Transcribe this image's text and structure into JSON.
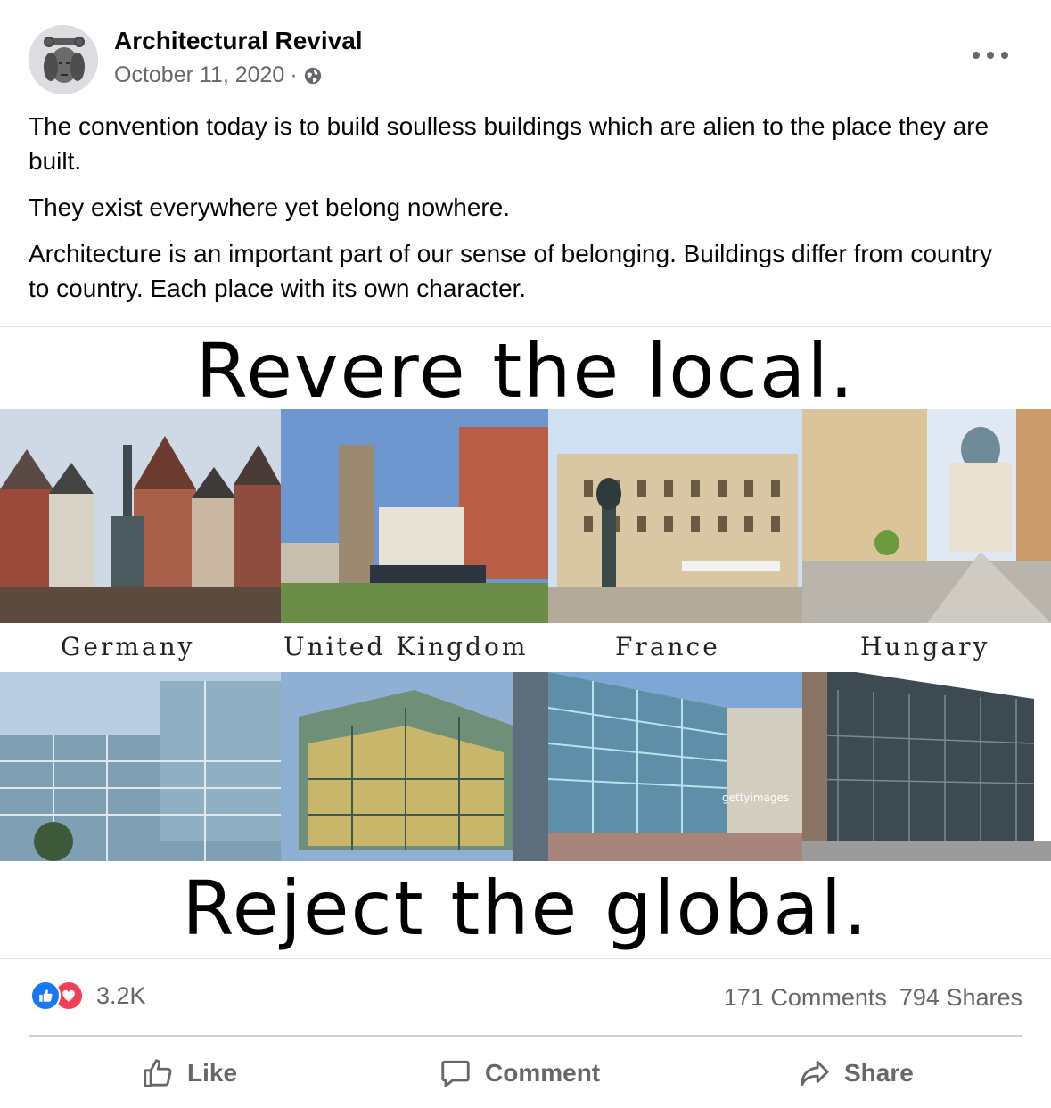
{
  "post": {
    "page_name": "Architectural Revival",
    "date": "October 11, 2020",
    "separator": "·",
    "privacy_icon": "globe-icon",
    "paragraphs": [
      "The convention today is to build soulless buildings which are alien to the place they are built.",
      "They exist everywhere yet belong nowhere.",
      "Architecture is an important part of our sense of belonging. Buildings differ from country to country. Each place with its own character."
    ]
  },
  "image": {
    "top_headline": "Revere the local.",
    "bottom_headline": "Reject the global.",
    "countries": [
      "Germany",
      "United Kingdom",
      "France",
      "Hungary"
    ],
    "watermark": "gettyimages"
  },
  "stats": {
    "reaction_icons": [
      "like-icon",
      "love-icon"
    ],
    "reaction_count": "3.2K",
    "comments": "171 Comments",
    "shares": "794 Shares"
  },
  "actions": {
    "like": "Like",
    "comment": "Comment",
    "share": "Share"
  },
  "colors": {
    "like_blue": "#1877f2",
    "love_red": "#f33e58",
    "secondary_text": "#65676b"
  }
}
